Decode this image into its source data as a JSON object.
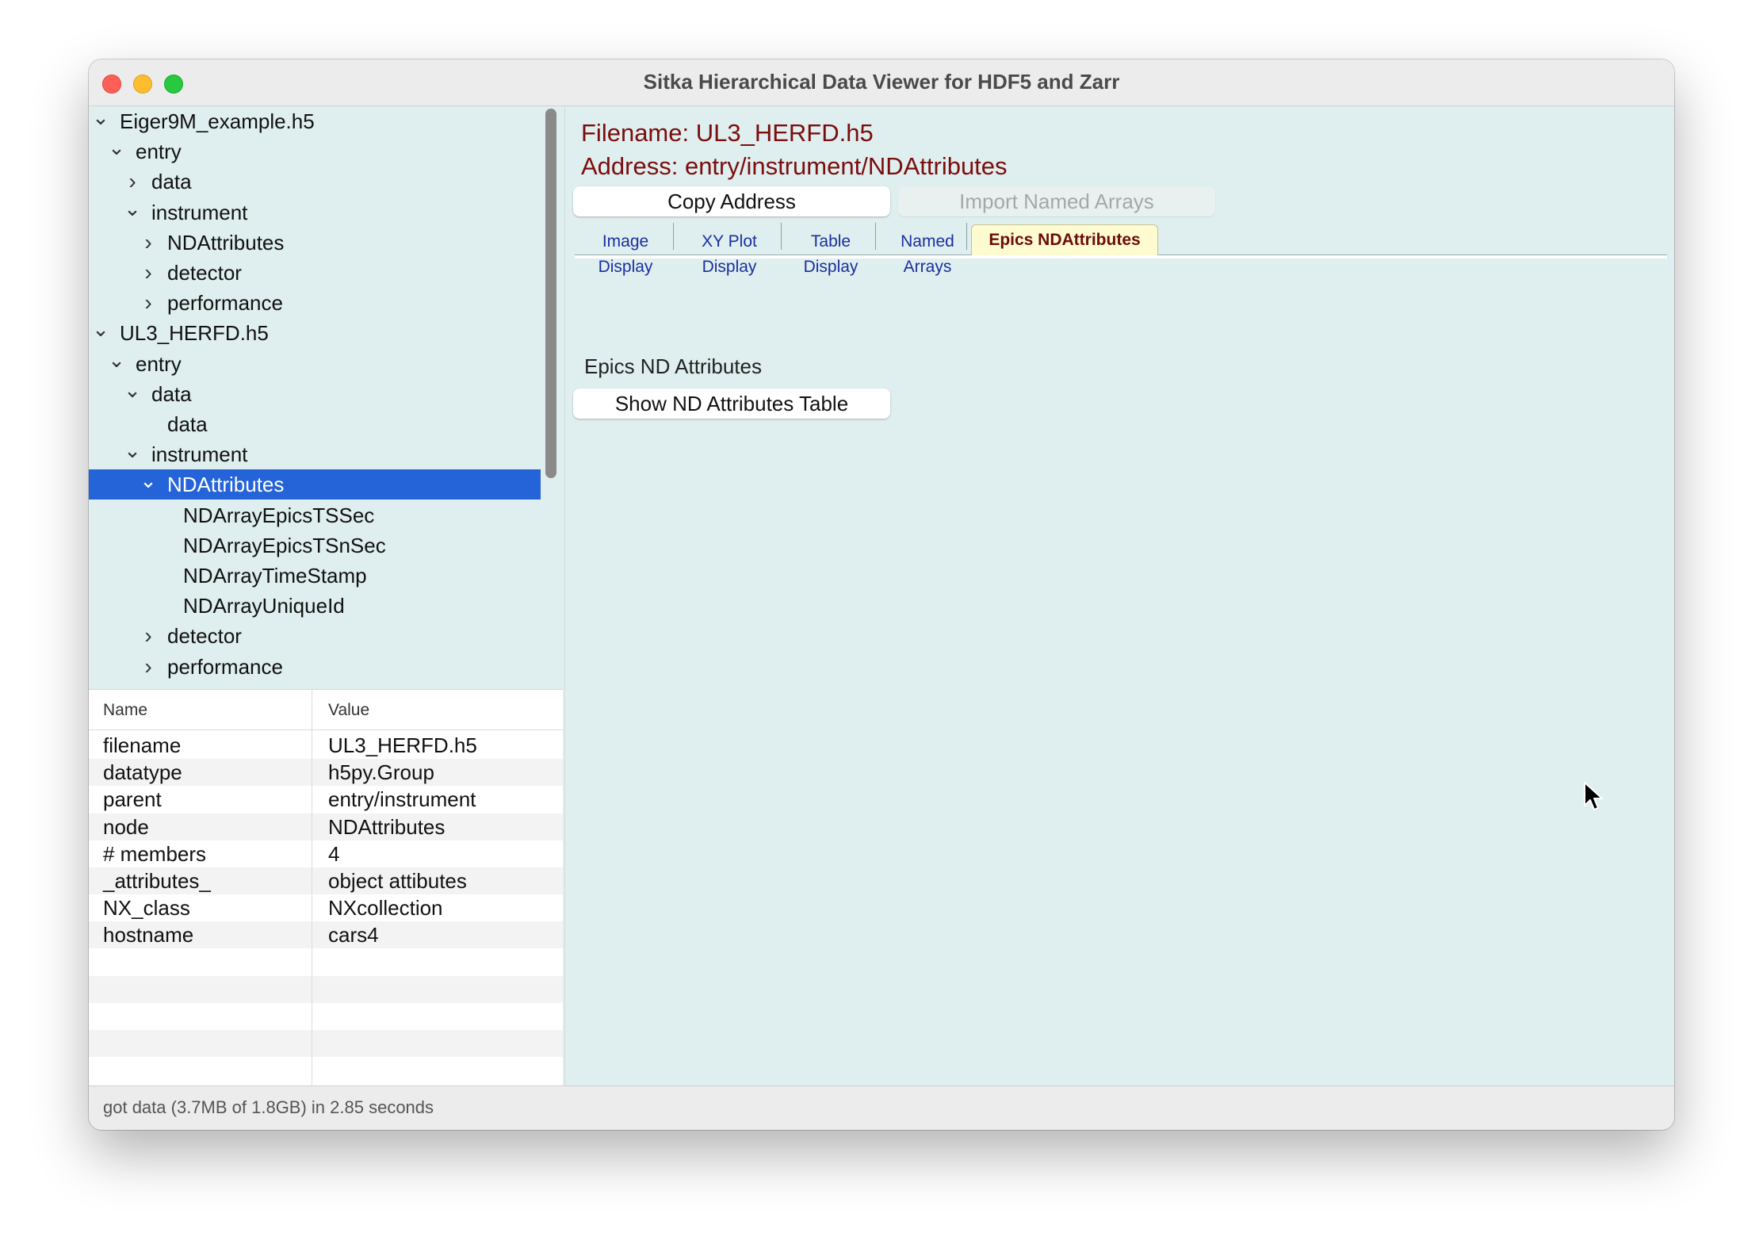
{
  "window": {
    "title": "Sitka Hierarchical Data Viewer for HDF5 and Zarr"
  },
  "tree": {
    "rows": [
      {
        "label": "Eiger9M_example.h5",
        "chevron": "expanded"
      },
      {
        "label": "entry",
        "chevron": "expanded"
      },
      {
        "label": "data",
        "chevron": "collapsed"
      },
      {
        "label": "instrument",
        "chevron": "expanded"
      },
      {
        "label": "NDAttributes",
        "chevron": "collapsed"
      },
      {
        "label": "detector",
        "chevron": "collapsed"
      },
      {
        "label": "performance",
        "chevron": "collapsed"
      },
      {
        "label": "UL3_HERFD.h5",
        "chevron": "expanded"
      },
      {
        "label": "entry",
        "chevron": "expanded"
      },
      {
        "label": "data",
        "chevron": "expanded"
      },
      {
        "label": "data",
        "chevron": "none"
      },
      {
        "label": "instrument",
        "chevron": "expanded"
      },
      {
        "label": "NDAttributes",
        "chevron": "expanded",
        "selected": true
      },
      {
        "label": "NDArrayEpicsTSSec",
        "chevron": "none"
      },
      {
        "label": "NDArrayEpicsTSnSec",
        "chevron": "none"
      },
      {
        "label": "NDArrayTimeStamp",
        "chevron": "none"
      },
      {
        "label": "NDArrayUniqueId",
        "chevron": "none"
      },
      {
        "label": "detector",
        "chevron": "collapsed"
      },
      {
        "label": "performance",
        "chevron": "collapsed"
      }
    ]
  },
  "attributes": {
    "header_name": "Name",
    "header_value": "Value",
    "rows": [
      {
        "name": "filename",
        "value": "UL3_HERFD.h5"
      },
      {
        "name": "datatype",
        "value": "h5py.Group"
      },
      {
        "name": "parent",
        "value": "entry/instrument"
      },
      {
        "name": "node",
        "value": "NDAttributes"
      },
      {
        "name": "# members",
        "value": "4"
      },
      {
        "name": "_attributes_",
        "value": "object attibutes"
      },
      {
        "name": "NX_class",
        "value": "NXcollection"
      },
      {
        "name": "hostname",
        "value": "cars4"
      }
    ]
  },
  "detail": {
    "filename": "Filename: UL3_HERFD.h5",
    "address": "Address: entry/instrument/NDAttributes",
    "copy_button": "Copy Address",
    "import_button": "Import Named Arrays",
    "tabs": [
      {
        "label": "Image Display"
      },
      {
        "label": "XY Plot Display"
      },
      {
        "label": "Table Display"
      },
      {
        "label": "Named Arrays"
      },
      {
        "label": "Epics NDAttributes",
        "active": true
      }
    ],
    "section_title": "Epics ND Attributes",
    "show_table_button": "Show ND Attributes Table"
  },
  "status": {
    "text": "got data (3.7MB of 1.8GB) in 2.85 seconds"
  },
  "colors": {
    "selection": "#2563d9",
    "address_text": "#7a0d0d",
    "tab_text": "#1a2fa0",
    "active_tab_bg": "#fffbd0",
    "pane_bg": "#dfeeee"
  }
}
